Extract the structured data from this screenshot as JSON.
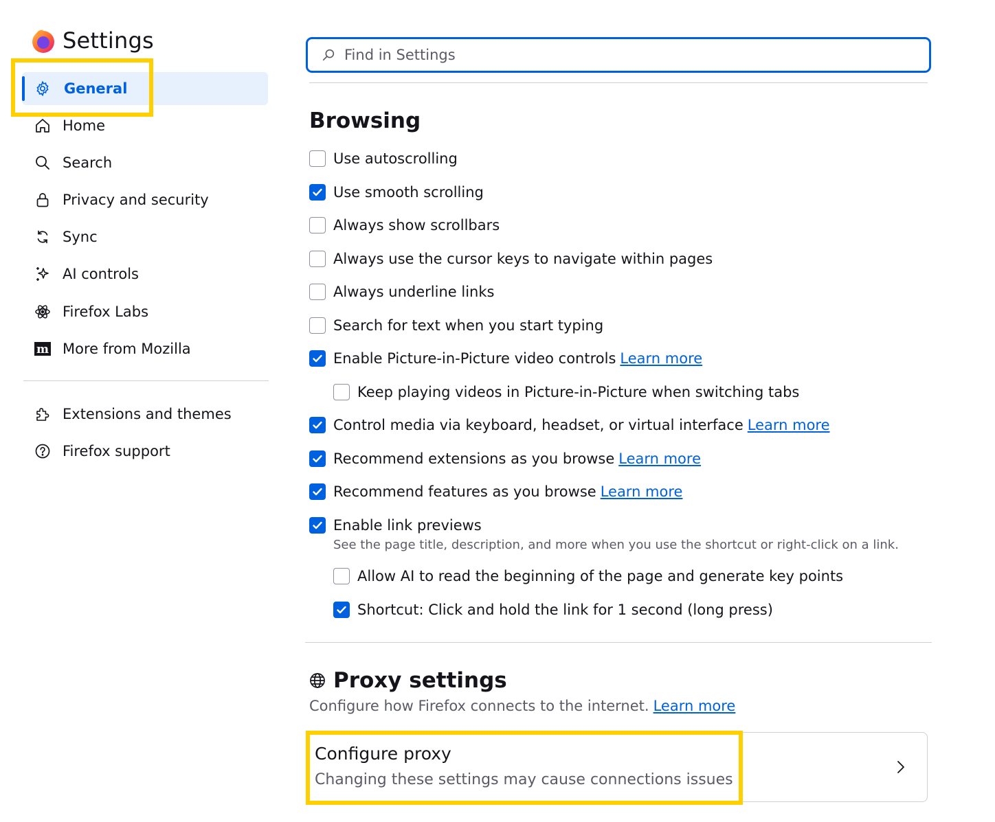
{
  "sidebar": {
    "title": "Settings",
    "logo_icon": "firefox-logo",
    "items": [
      {
        "label": "General",
        "icon": "gear-icon",
        "selected": true
      },
      {
        "label": "Home",
        "icon": "home-icon"
      },
      {
        "label": "Search",
        "icon": "search-icon"
      },
      {
        "label": "Privacy and security",
        "icon": "lock-icon"
      },
      {
        "label": "Sync",
        "icon": "sync-icon"
      },
      {
        "label": "AI controls",
        "icon": "sparkle-icon"
      },
      {
        "label": "Firefox Labs",
        "icon": "atom-icon"
      },
      {
        "label": "More from Mozilla",
        "icon": "mozilla-m-icon"
      }
    ],
    "footer_items": [
      {
        "label": "Extensions and themes",
        "icon": "puzzle-icon"
      },
      {
        "label": "Firefox support",
        "icon": "help-icon"
      }
    ]
  },
  "search": {
    "placeholder": "Find in Settings"
  },
  "browsing": {
    "title": "Browsing",
    "options": [
      {
        "label": "Use autoscrolling",
        "checked": false
      },
      {
        "label": "Use smooth scrolling",
        "checked": true
      },
      {
        "label": "Always show scrollbars",
        "checked": false
      },
      {
        "label": "Always use the cursor keys to navigate within pages",
        "checked": false
      },
      {
        "label": "Always underline links",
        "checked": false
      },
      {
        "label": "Search for text when you start typing",
        "checked": false
      },
      {
        "label": "Enable Picture-in-Picture video controls",
        "checked": true,
        "link": "Learn more"
      },
      {
        "label": "Keep playing videos in Picture-in-Picture when switching tabs",
        "checked": false
      },
      {
        "label": "Control media via keyboard, headset, or virtual interface",
        "checked": true,
        "link": "Learn more"
      },
      {
        "label": "Recommend extensions as you browse",
        "checked": true,
        "link": "Learn more"
      },
      {
        "label": "Recommend features as you browse",
        "checked": true,
        "link": "Learn more"
      },
      {
        "label": "Enable link previews",
        "checked": true
      },
      {
        "label": "Allow AI to read the beginning of the page and generate key points",
        "checked": false
      },
      {
        "label": "Shortcut: Click and hold the link for 1 second (long press)",
        "checked": true
      }
    ],
    "link_previews_hint": "See the page title, description, and more when you use the shortcut or right-click on a link."
  },
  "proxy": {
    "title": "Proxy settings",
    "icon": "globe-icon",
    "description": "Configure how Firefox connects to the internet.",
    "link": "Learn more",
    "card_title": "Configure proxy",
    "card_subtitle": "Changing these settings may cause connections issues"
  },
  "colors": {
    "accent": "#0061e0",
    "highlight": "#ffcf00",
    "selected_bg": "#e7f0fd"
  }
}
